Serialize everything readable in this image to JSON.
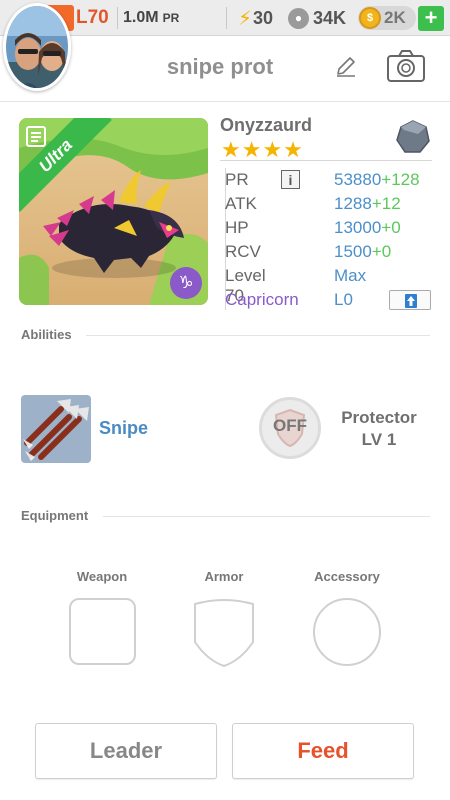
{
  "topbar": {
    "level": "L70",
    "power": "1.0M",
    "power_unit": "PR",
    "energy": "30",
    "energy_icon": "lightning-icon",
    "paws": "34K",
    "paw_icon": "paw-icon",
    "gold": "2K",
    "gold_icon": "coin-icon",
    "plus": "+"
  },
  "profile": {
    "team_name": "snipe prot",
    "avatar": "player-avatar-photo"
  },
  "creature": {
    "rarity": "Ultra",
    "name": "Onyzzaurd",
    "stars": "★★★★",
    "star_count": 4,
    "element_icon": "stone-element-icon",
    "stats": {
      "pr_label": "PR",
      "pr_value": "53880",
      "pr_bonus": "+128",
      "atk_label": "ATK",
      "atk_value": "1288",
      "atk_bonus": "+12",
      "hp_label": "HP",
      "hp_value": "13000",
      "hp_bonus": "+0",
      "rcv_label": "RCV",
      "rcv_value": "1500",
      "rcv_bonus": "+0",
      "level_label": "Level 70",
      "level_value": "Max",
      "zodiac_label": "Capricorn",
      "zodiac_value": "L0",
      "info_glyph": "i",
      "zodiac_glyph": "♑"
    }
  },
  "abilities": {
    "title": "Abilities",
    "ability1_name": "Snipe",
    "ability2_state": "OFF",
    "ability2_name": "Protector",
    "ability2_level": "LV 1"
  },
  "equipment": {
    "title": "Equipment",
    "weapon": "Weapon",
    "armor": "Armor",
    "accessory": "Accessory"
  },
  "actions": {
    "leader": "Leader",
    "feed": "Feed"
  },
  "colors": {
    "accent_orange": "#e8522b",
    "stat_blue": "#4d8fc9",
    "bonus_green": "#5cc85a",
    "zodiac_purple": "#8a5ac9",
    "rarity_green": "#3bb84a"
  }
}
